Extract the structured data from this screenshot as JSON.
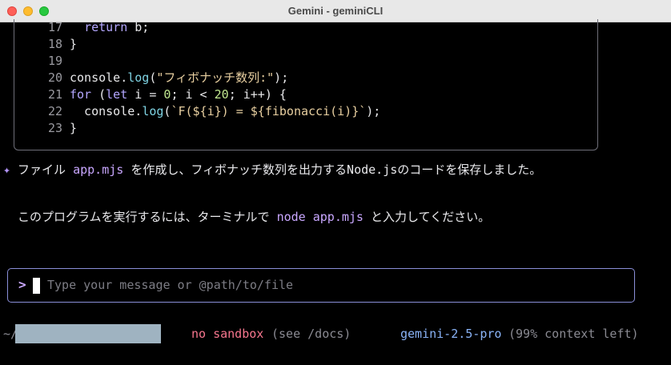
{
  "window": {
    "title": "Gemini - geminiCLI"
  },
  "code": {
    "lines": [
      {
        "num": "17",
        "parts": [
          [
            "",
            "  "
          ],
          [
            "kw",
            "return"
          ],
          [
            "",
            " b;"
          ]
        ]
      },
      {
        "num": "18",
        "parts": [
          [
            "",
            "}"
          ]
        ]
      },
      {
        "num": "19",
        "parts": []
      },
      {
        "num": "20",
        "parts": [
          [
            "",
            "console."
          ],
          [
            "fn",
            "log"
          ],
          [
            "",
            "("
          ],
          [
            "str",
            "\"フィボナッチ数列:\""
          ],
          [
            "",
            ");"
          ]
        ]
      },
      {
        "num": "21",
        "parts": [
          [
            "kw",
            "for"
          ],
          [
            "",
            " ("
          ],
          [
            "kw",
            "let"
          ],
          [
            "",
            " i = "
          ],
          [
            "num",
            "0"
          ],
          [
            "",
            "; i < "
          ],
          [
            "num",
            "20"
          ],
          [
            "",
            "; i++) {"
          ]
        ]
      },
      {
        "num": "22",
        "parts": [
          [
            "",
            "  console."
          ],
          [
            "fn",
            "log"
          ],
          [
            "",
            "("
          ],
          [
            "str",
            "`F(${i}) = ${fibonacci(i)}`"
          ],
          [
            "",
            ");"
          ]
        ]
      },
      {
        "num": "23",
        "parts": [
          [
            "",
            "}"
          ]
        ]
      }
    ]
  },
  "messages": {
    "sparkle": "✦",
    "line1_a": " ファイル ",
    "line1_file": "app.mjs",
    "line1_b": " を作成し、フィボナッチ数列を出力するNode.jsのコードを保存しました。",
    "line2_a": "このプログラムを実行するには、ターミナルで ",
    "line2_cmd": "node app.mjs",
    "line2_b": " と入力してください。"
  },
  "input": {
    "prompt": ">",
    "placeholder": "Type your message or @path/to/file"
  },
  "footer": {
    "path_prefix": "~/",
    "sandbox": "no sandbox",
    "sandbox_note": "(see /docs)",
    "model": "gemini-2.5-pro",
    "context": "(99% context left)"
  },
  "colors": {
    "accent": "#c9a7ff",
    "sandbox": "#f7768e",
    "model": "#8ab4f8",
    "muted": "#8a8a92"
  }
}
